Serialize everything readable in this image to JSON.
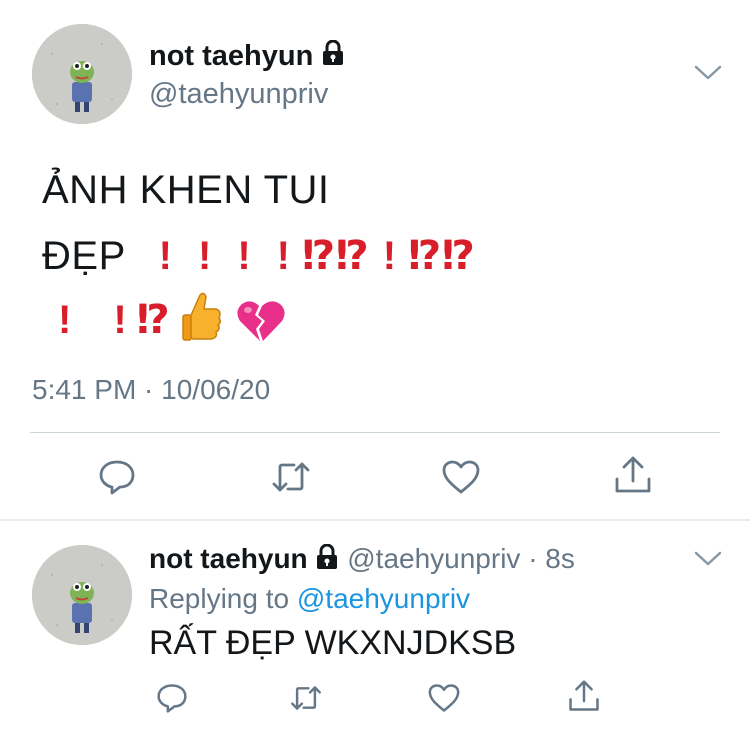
{
  "main_tweet": {
    "display_name": "not taehyun",
    "handle": "@taehyunpriv",
    "text_line1": "ẢNH KHEN TUI",
    "text_line2_word": "ĐẸP",
    "marks_line2": [
      "!",
      "!",
      "!",
      "!",
      "⁉",
      "⁉",
      "!",
      "⁉",
      "⁉"
    ],
    "marks_line3": [
      "!",
      "!",
      "⁉"
    ],
    "emoji": [
      "thumbs-up-icon",
      "broken-heart-icon"
    ],
    "timestamp": "5:41 PM · 10/06/20",
    "actions": [
      "reply-icon",
      "retweet-icon",
      "like-icon",
      "share-icon"
    ]
  },
  "reply_tweet": {
    "display_name": "not taehyun",
    "handle": "@taehyunpriv",
    "time": "· 8s",
    "replying_prefix": "Replying to",
    "replying_handle": "@taehyunpriv",
    "text": "RẤT ĐẸP WKXNJDKSB",
    "actions": [
      "reply-icon",
      "retweet-icon",
      "like-icon",
      "share-icon"
    ]
  },
  "colors": {
    "text": "#14171a",
    "secondary": "#657786",
    "link": "#1b95e0",
    "exclamation": "#d81e2a",
    "divider": "#ccd6dd"
  }
}
